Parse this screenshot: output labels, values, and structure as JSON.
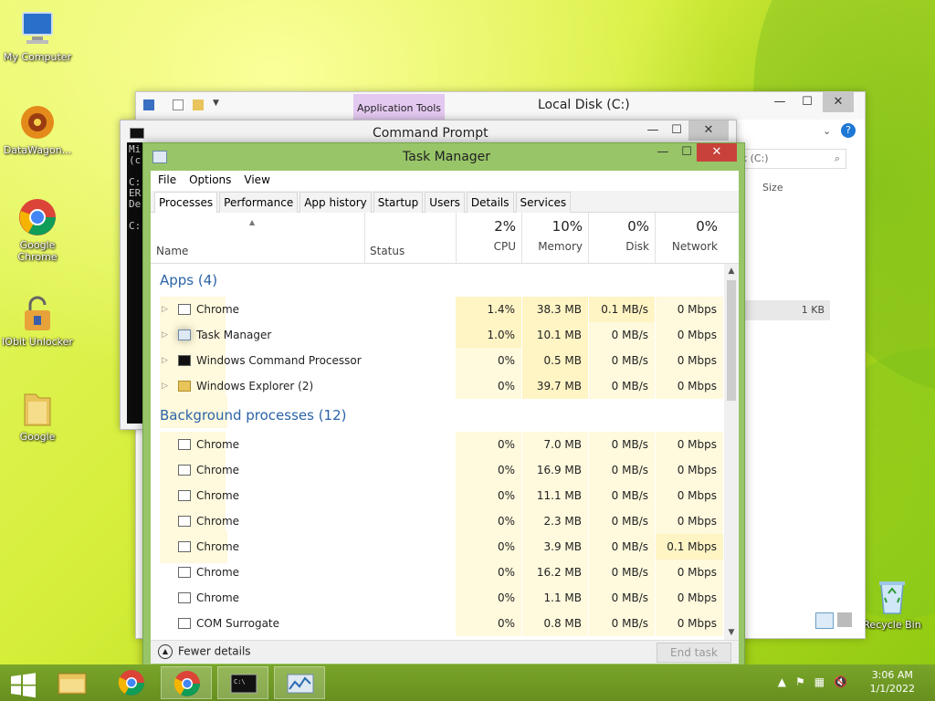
{
  "desktop": {
    "icons": [
      {
        "label": "My Computer"
      },
      {
        "label": "DataWagon..."
      },
      {
        "label": "Google Chrome"
      },
      {
        "label": "IObit Unlocker"
      },
      {
        "label": "Google"
      },
      {
        "label": "Recycle Bin"
      }
    ]
  },
  "explorer": {
    "ribbon_context": "Application Tools",
    "title": "Local Disk (C:)",
    "search_placeholder": "Search Local Disk (C:)",
    "search_visible": "sk (C:)",
    "column_size": "Size",
    "row_size": "1 KB"
  },
  "cmd": {
    "title": "Command Prompt",
    "body_lines": "Mi\n(c\n\nC:\nER\nDe\n\nC:"
  },
  "taskmanager": {
    "title": "Task Manager",
    "menu": [
      "File",
      "Options",
      "View"
    ],
    "tabs": [
      "Processes",
      "Performance",
      "App history",
      "Startup",
      "Users",
      "Details",
      "Services"
    ],
    "active_tab": "Processes",
    "columns": {
      "name": "Name",
      "status": "Status",
      "cpu": {
        "pct": "2%",
        "label": "CPU"
      },
      "memory": {
        "pct": "10%",
        "label": "Memory"
      },
      "disk": {
        "pct": "0%",
        "label": "Disk"
      },
      "network": {
        "pct": "0%",
        "label": "Network"
      }
    },
    "groups": [
      {
        "title": "Apps (4)",
        "rows": [
          {
            "name": "Chrome",
            "icon": "app-window-icon",
            "cpu": "1.4%",
            "mem": "38.3 MB",
            "disk": "0.1 MB/s",
            "net": "0 Mbps"
          },
          {
            "name": "Task Manager",
            "icon": "task-manager-icon",
            "cpu": "1.0%",
            "mem": "10.1 MB",
            "disk": "0 MB/s",
            "net": "0 Mbps"
          },
          {
            "name": "Windows Command Processor",
            "icon": "cmd-icon",
            "cpu": "0%",
            "mem": "0.5 MB",
            "disk": "0 MB/s",
            "net": "0 Mbps"
          },
          {
            "name": "Windows Explorer (2)",
            "icon": "folder-icon",
            "cpu": "0%",
            "mem": "39.7 MB",
            "disk": "0 MB/s",
            "net": "0 Mbps"
          }
        ]
      },
      {
        "title": "Background processes (12)",
        "rows": [
          {
            "name": "Chrome",
            "icon": "app-window-icon",
            "cpu": "0%",
            "mem": "7.0 MB",
            "disk": "0 MB/s",
            "net": "0 Mbps"
          },
          {
            "name": "Chrome",
            "icon": "app-window-icon",
            "cpu": "0%",
            "mem": "16.9 MB",
            "disk": "0 MB/s",
            "net": "0 Mbps"
          },
          {
            "name": "Chrome",
            "icon": "app-window-icon",
            "cpu": "0%",
            "mem": "11.1 MB",
            "disk": "0 MB/s",
            "net": "0 Mbps"
          },
          {
            "name": "Chrome",
            "icon": "app-window-icon",
            "cpu": "0%",
            "mem": "2.3 MB",
            "disk": "0 MB/s",
            "net": "0 Mbps"
          },
          {
            "name": "Chrome",
            "icon": "app-window-icon",
            "cpu": "0%",
            "mem": "3.9 MB",
            "disk": "0 MB/s",
            "net": "0.1 Mbps"
          },
          {
            "name": "Chrome",
            "icon": "app-window-icon",
            "cpu": "0%",
            "mem": "16.2 MB",
            "disk": "0 MB/s",
            "net": "0 Mbps"
          },
          {
            "name": "Chrome",
            "icon": "app-window-icon",
            "cpu": "0%",
            "mem": "1.1 MB",
            "disk": "0 MB/s",
            "net": "0 Mbps"
          },
          {
            "name": "COM Surrogate",
            "icon": "app-window-icon",
            "cpu": "0%",
            "mem": "0.8 MB",
            "disk": "0 MB/s",
            "net": "0 Mbps"
          }
        ]
      }
    ],
    "footer": {
      "fewer_details": "Fewer details",
      "end_task": "End task"
    }
  },
  "taskbar": {
    "time": "3:06 AM",
    "date": "1/1/2022"
  }
}
